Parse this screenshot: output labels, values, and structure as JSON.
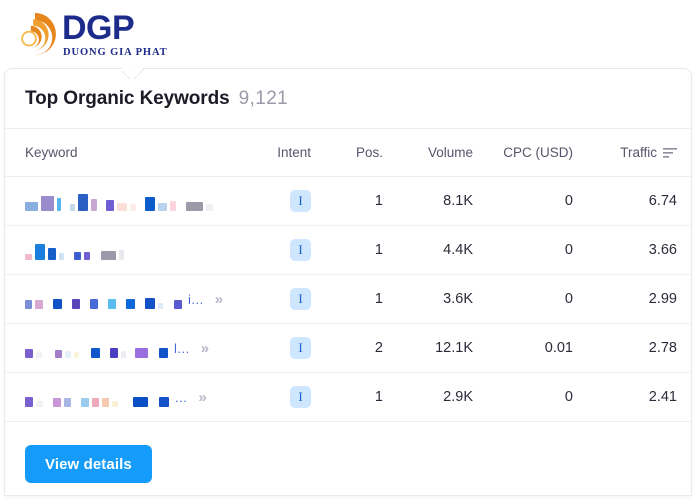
{
  "brand": {
    "mark_icon": "orange-spiral-icon",
    "name": "DGP",
    "tagline": "DUONG GIA PHAT",
    "colors": {
      "mark": "#E8861E",
      "text": "#1D2B8A"
    }
  },
  "card": {
    "title": "Top Organic Keywords",
    "count": "9,121"
  },
  "table": {
    "columns": [
      {
        "key": "keyword",
        "label": "Keyword"
      },
      {
        "key": "intent",
        "label": "Intent"
      },
      {
        "key": "pos",
        "label": "Pos."
      },
      {
        "key": "volume",
        "label": "Volume"
      },
      {
        "key": "cpc",
        "label": "CPC (USD)"
      },
      {
        "key": "traffic",
        "label": "Traffic",
        "sort_icon": "sort-descending-icon",
        "sorted": true
      }
    ],
    "rows": [
      {
        "keyword_redacted": true,
        "keyword_ellipsis": "",
        "has_expand": false,
        "expand_icon": "chevron-double-right-icon",
        "intent": "I",
        "pos": "1",
        "volume": "8.1K",
        "cpc": "0",
        "traffic": "6.74",
        "blocks": [
          {
            "w": 13,
            "h": 9,
            "c": "#8aaee0",
            "mt": 0
          },
          {
            "w": 13,
            "h": 15,
            "c": "#9a8ccc",
            "mt": 0
          },
          {
            "w": 4,
            "h": 13,
            "c": "#56b4ef",
            "mt": 0
          },
          {
            "w": 3,
            "h": 0,
            "c": "transparent",
            "mt": 0
          },
          {
            "w": 5,
            "h": 7,
            "c": "#c8d6ea",
            "mt": 0
          },
          {
            "w": 10,
            "h": 17,
            "c": "#2c5fc4",
            "mt": 0
          },
          {
            "w": 6,
            "h": 12,
            "c": "#c8a8d2",
            "mt": 0
          },
          {
            "w": 3,
            "h": 0,
            "c": "transparent",
            "mt": 0
          },
          {
            "w": 8,
            "h": 11,
            "c": "#6e5fd4",
            "mt": 0
          },
          {
            "w": 10,
            "h": 8,
            "c": "#fbe0da",
            "mt": 0
          },
          {
            "w": 6,
            "h": 7,
            "c": "#fdeee9",
            "mt": 0
          },
          {
            "w": 3,
            "h": 0,
            "c": "transparent",
            "mt": 0
          },
          {
            "w": 10,
            "h": 14,
            "c": "#0b5ec9",
            "mt": 0
          },
          {
            "w": 9,
            "h": 8,
            "c": "#b9d2ec",
            "mt": 0
          },
          {
            "w": 6,
            "h": 10,
            "c": "#fbd4dd",
            "mt": 0
          },
          {
            "w": 4,
            "h": 0,
            "c": "transparent",
            "mt": 0
          },
          {
            "w": 17,
            "h": 9,
            "c": "#9a9aa8",
            "mt": 0
          },
          {
            "w": 7,
            "h": 7,
            "c": "#f0f0f4",
            "mt": 0
          }
        ]
      },
      {
        "keyword_redacted": true,
        "keyword_ellipsis": "",
        "has_expand": false,
        "expand_icon": "chevron-double-right-icon",
        "intent": "I",
        "pos": "1",
        "volume": "4.4K",
        "cpc": "0",
        "traffic": "3.66",
        "blocks": [
          {
            "w": 7,
            "h": 6,
            "c": "#f0b9cc",
            "mt": 0
          },
          {
            "w": 10,
            "h": 16,
            "c": "#1b7fe0",
            "mt": 0
          },
          {
            "w": 8,
            "h": 12,
            "c": "#1460c8",
            "mt": 0
          },
          {
            "w": 5,
            "h": 7,
            "c": "#cfe3f5",
            "mt": 0
          },
          {
            "w": 4,
            "h": 0,
            "c": "transparent",
            "mt": 0
          },
          {
            "w": 7,
            "h": 8,
            "c": "#3b5fd0",
            "mt": 0
          },
          {
            "w": 6,
            "h": 8,
            "c": "#6e5fd4",
            "mt": 0
          },
          {
            "w": 5,
            "h": 0,
            "c": "transparent",
            "mt": 0
          },
          {
            "w": 15,
            "h": 9,
            "c": "#9a9aa8",
            "mt": 0
          },
          {
            "w": 5,
            "h": 10,
            "c": "#e8e8ee",
            "mt": 0
          }
        ]
      },
      {
        "keyword_redacted": true,
        "keyword_ellipsis": "i...",
        "has_expand": true,
        "expand_icon": "chevron-double-right-icon",
        "intent": "I",
        "pos": "1",
        "volume": "3.6K",
        "cpc": "0",
        "traffic": "2.99",
        "blocks": [
          {
            "w": 7,
            "h": 9,
            "c": "#7a8fd8",
            "mt": 0
          },
          {
            "w": 8,
            "h": 9,
            "c": "#d7a8d2",
            "mt": 0
          },
          {
            "w": 4,
            "h": 0,
            "c": "transparent",
            "mt": 0
          },
          {
            "w": 9,
            "h": 10,
            "c": "#1452c8",
            "mt": 0
          },
          {
            "w": 4,
            "h": 0,
            "c": "transparent",
            "mt": 0
          },
          {
            "w": 8,
            "h": 10,
            "c": "#5a46bb",
            "mt": 0
          },
          {
            "w": 4,
            "h": 0,
            "c": "transparent",
            "mt": 0
          },
          {
            "w": 8,
            "h": 10,
            "c": "#4a6ad8",
            "mt": 0
          },
          {
            "w": 4,
            "h": 0,
            "c": "transparent",
            "mt": 0
          },
          {
            "w": 8,
            "h": 10,
            "c": "#5bbcf0",
            "mt": 0
          },
          {
            "w": 4,
            "h": 0,
            "c": "transparent",
            "mt": 0
          },
          {
            "w": 9,
            "h": 10,
            "c": "#0e6ad8",
            "mt": 0
          },
          {
            "w": 4,
            "h": 0,
            "c": "transparent",
            "mt": 0
          },
          {
            "w": 10,
            "h": 11,
            "c": "#1452c8",
            "mt": 0
          },
          {
            "w": 5,
            "h": 6,
            "c": "#dfe9f7",
            "mt": 0
          },
          {
            "w": 5,
            "h": 0,
            "c": "transparent",
            "mt": 0
          },
          {
            "w": 8,
            "h": 9,
            "c": "#5a5ad0",
            "mt": 0
          }
        ]
      },
      {
        "keyword_redacted": true,
        "keyword_ellipsis": "l...",
        "has_expand": true,
        "expand_icon": "chevron-double-right-icon",
        "intent": "I",
        "pos": "2",
        "volume": "12.1K",
        "cpc": "0.01",
        "traffic": "2.78",
        "blocks": [
          {
            "w": 8,
            "h": 9,
            "c": "#7a5fd0",
            "mt": 0
          },
          {
            "w": 6,
            "h": 6,
            "c": "#f2f2f6",
            "mt": 0
          },
          {
            "w": 7,
            "h": 0,
            "c": "transparent",
            "mt": 0
          },
          {
            "w": 7,
            "h": 8,
            "c": "#a07fc8",
            "mt": 0
          },
          {
            "w": 6,
            "h": 7,
            "c": "#e4f0fa",
            "mt": 0
          },
          {
            "w": 5,
            "h": 6,
            "c": "#faf3dc",
            "mt": 0
          },
          {
            "w": 6,
            "h": 0,
            "c": "transparent",
            "mt": 0
          },
          {
            "w": 9,
            "h": 10,
            "c": "#0e56cc",
            "mt": 0
          },
          {
            "w": 4,
            "h": 0,
            "c": "transparent",
            "mt": 0
          },
          {
            "w": 8,
            "h": 10,
            "c": "#4a3fc0",
            "mt": 0
          },
          {
            "w": 5,
            "h": 7,
            "c": "#eceef2",
            "mt": 0
          },
          {
            "w": 3,
            "h": 0,
            "c": "transparent",
            "mt": 0
          },
          {
            "w": 13,
            "h": 10,
            "c": "#9a6fe0",
            "mt": 0
          },
          {
            "w": 5,
            "h": 0,
            "c": "transparent",
            "mt": 0
          },
          {
            "w": 9,
            "h": 10,
            "c": "#1452c8",
            "mt": 0
          }
        ]
      },
      {
        "keyword_redacted": true,
        "keyword_ellipsis": "...",
        "has_expand": true,
        "expand_icon": "chevron-double-right-icon",
        "intent": "I",
        "pos": "1",
        "volume": "2.9K",
        "cpc": "0",
        "traffic": "2.41",
        "blocks": [
          {
            "w": 8,
            "h": 10,
            "c": "#7a5fd0",
            "mt": 0
          },
          {
            "w": 7,
            "h": 6,
            "c": "#f2f2f6",
            "mt": 0
          },
          {
            "w": 4,
            "h": 0,
            "c": "transparent",
            "mt": 0
          },
          {
            "w": 8,
            "h": 9,
            "c": "#c896d6",
            "mt": 0
          },
          {
            "w": 7,
            "h": 9,
            "c": "#a8b6e6",
            "mt": 0
          },
          {
            "w": 4,
            "h": 0,
            "c": "transparent",
            "mt": 0
          },
          {
            "w": 8,
            "h": 9,
            "c": "#9ccbf0",
            "mt": 0
          },
          {
            "w": 7,
            "h": 9,
            "c": "#f0a8bc",
            "mt": 0
          },
          {
            "w": 7,
            "h": 9,
            "c": "#f6c8b0",
            "mt": 0
          },
          {
            "w": 6,
            "h": 6,
            "c": "#fbf0d8",
            "mt": 0
          },
          {
            "w": 9,
            "h": 0,
            "c": "transparent",
            "mt": 0
          },
          {
            "w": 15,
            "h": 10,
            "c": "#0b4fc4",
            "mt": 0
          },
          {
            "w": 5,
            "h": 0,
            "c": "transparent",
            "mt": 0
          },
          {
            "w": 10,
            "h": 10,
            "c": "#1452c8",
            "mt": 0
          }
        ]
      }
    ]
  },
  "footer": {
    "view_details_label": "View details",
    "button_color": "#159BFA"
  }
}
